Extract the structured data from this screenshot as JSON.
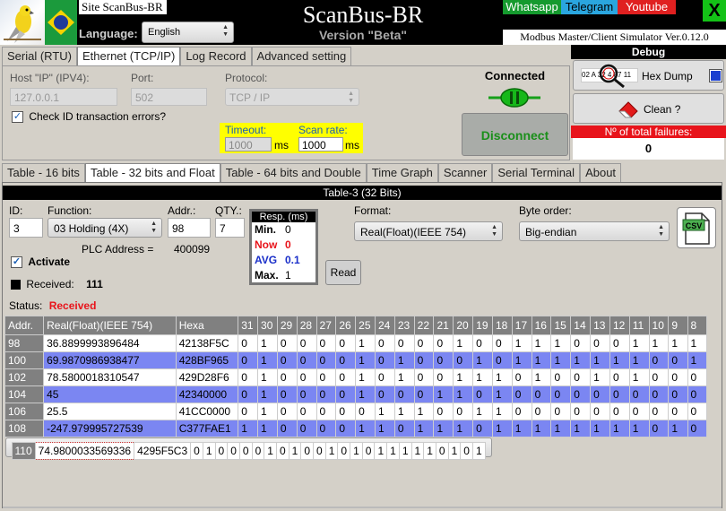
{
  "header": {
    "site_link": "Site ScanBus-BR",
    "language_label": "Language:",
    "language_value": "English",
    "title": "ScanBus-BR",
    "version": "Version \"Beta\"",
    "subtitle": "Modbus Master/Client Simulator Ver.0.12.0",
    "social": {
      "whatsapp": "Whatsapp",
      "telegram": "Telegram",
      "youtube": "Youtube"
    },
    "close": "X"
  },
  "top_tabs": [
    "Serial (RTU)",
    "Ethernet (TCP/IP)",
    "Log Record",
    "Advanced setting"
  ],
  "top_tab_active": 1,
  "connection": {
    "host_label": "Host \"IP\" (IPV4):",
    "host_value": "127.0.0.1",
    "port_label": "Port:",
    "port_value": "502",
    "protocol_label": "Protocol:",
    "protocol_value": "TCP / IP",
    "check_id_label": "Check ID transaction errors?",
    "check_id_checked": true,
    "timeout_label": "Timeout:",
    "timeout_value": "1000",
    "timeout_unit": "ms",
    "scanrate_label": "Scan rate:",
    "scanrate_value": "1000",
    "scanrate_unit": "ms",
    "status_label": "Connected",
    "disconnect_label": "Disconnect"
  },
  "debug": {
    "title": "Debug",
    "hexdump_label": "Hex Dump",
    "hexdump_icon_text": "02 A 32 4 87 11",
    "clean_label": "Clean ?",
    "failures_label": "Nº of total failures:",
    "failures_value": "0"
  },
  "main_tabs": [
    "Table - 16 bits",
    "Table - 32 bits and Float",
    "Table - 64 bits and Double",
    "Time Graph",
    "Scanner",
    "Serial Terminal",
    "About"
  ],
  "main_tab_active": 1,
  "table_panel": {
    "title": "Table-3 (32 Bits)",
    "id_label": "ID:",
    "id_value": "3",
    "function_label": "Function:",
    "function_value": "03 Holding (4X)",
    "addr_label": "Addr.:",
    "addr_value": "98",
    "qty_label": "QTY.:",
    "qty_value": "7",
    "plc_label": "PLC Address =",
    "plc_value": "400099",
    "activate_label": "Activate",
    "received_label": "Received:",
    "received_value": "111",
    "status_label": "Status:",
    "status_value": "Received",
    "resp": {
      "title": "Resp. (ms)",
      "min_label": "Min.",
      "min_value": "0",
      "now_label": "Now",
      "now_value": "0",
      "avg_label": "AVG",
      "avg_value": "0.1",
      "max_label": "Max.",
      "max_value": "1"
    },
    "read_label": "Read",
    "format_label": "Format:",
    "format_value": "Real(Float)(IEEE 754)",
    "byteorder_label": "Byte order:",
    "byteorder_value": "Big-endian",
    "csv_label": "CSV"
  },
  "grid": {
    "columns": [
      "Addr.",
      "Real(Float)(IEEE 754)",
      "Hexa",
      "31",
      "30",
      "29",
      "28",
      "27",
      "26",
      "25",
      "24",
      "23",
      "22",
      "21",
      "20",
      "19",
      "18",
      "17",
      "16",
      "15",
      "14",
      "13",
      "12",
      "11",
      "10",
      "9",
      "8"
    ],
    "rows": [
      {
        "addr": "98",
        "real": "36.8899993896484",
        "hex": "42138F5C",
        "bits": [
          "0",
          "1",
          "0",
          "0",
          "0",
          "0",
          "1",
          "0",
          "0",
          "0",
          "0",
          "1",
          "0",
          "0",
          "1",
          "1",
          "1",
          "0",
          "0",
          "0",
          "1",
          "1",
          "1",
          "1"
        ]
      },
      {
        "addr": "100",
        "real": "69.9870986938477",
        "hex": "428BF965",
        "bits": [
          "0",
          "1",
          "0",
          "0",
          "0",
          "0",
          "1",
          "0",
          "1",
          "0",
          "0",
          "0",
          "1",
          "0",
          "1",
          "1",
          "1",
          "1",
          "1",
          "1",
          "1",
          "0",
          "0",
          "1"
        ]
      },
      {
        "addr": "102",
        "real": "78.5800018310547",
        "hex": "429D28F6",
        "bits": [
          "0",
          "1",
          "0",
          "0",
          "0",
          "0",
          "1",
          "0",
          "1",
          "0",
          "0",
          "1",
          "1",
          "1",
          "0",
          "1",
          "0",
          "0",
          "1",
          "0",
          "1",
          "0",
          "0",
          "0"
        ]
      },
      {
        "addr": "104",
        "real": "45",
        "hex": "42340000",
        "bits": [
          "0",
          "1",
          "0",
          "0",
          "0",
          "0",
          "1",
          "0",
          "0",
          "0",
          "1",
          "1",
          "0",
          "1",
          "0",
          "0",
          "0",
          "0",
          "0",
          "0",
          "0",
          "0",
          "0",
          "0"
        ]
      },
      {
        "addr": "106",
        "real": "25.5",
        "hex": "41CC0000",
        "bits": [
          "0",
          "1",
          "0",
          "0",
          "0",
          "0",
          "0",
          "1",
          "1",
          "1",
          "0",
          "0",
          "1",
          "1",
          "0",
          "0",
          "0",
          "0",
          "0",
          "0",
          "0",
          "0",
          "0",
          "0"
        ]
      },
      {
        "addr": "108",
        "real": "-247.979995727539",
        "hex": "C377FAE1",
        "bits": [
          "1",
          "1",
          "0",
          "0",
          "0",
          "0",
          "1",
          "1",
          "0",
          "1",
          "1",
          "1",
          "0",
          "1",
          "1",
          "1",
          "1",
          "1",
          "1",
          "1",
          "1",
          "0",
          "1",
          "0"
        ]
      },
      {
        "addr": "110",
        "real": "74.9800033569336",
        "hex": "4295F5C3",
        "bits": [
          "0",
          "1",
          "0",
          "0",
          "0",
          "0",
          "1",
          "0",
          "1",
          "0",
          "0",
          "1",
          "0",
          "1",
          "0",
          "1",
          "1",
          "1",
          "1",
          "1",
          "0",
          "1",
          "0",
          "1"
        ]
      }
    ]
  },
  "colors": {
    "row_highlight": "#7b86f2",
    "status_received": "#e8141b",
    "timeout_bg": "#ffff00",
    "disconnect_text": "#1a8f1a"
  }
}
